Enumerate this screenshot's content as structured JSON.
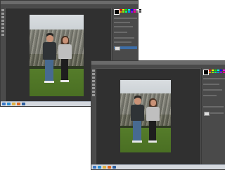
{
  "app": {
    "name": "Adobe Photoshop"
  },
  "colors": {
    "ui_bg": "#535353",
    "canvas_bg": "#303030",
    "panel_bg": "#4a4a4a",
    "selection_blue": "#3d6ea8",
    "taskbar": "#d4d8de"
  },
  "windows": [
    {
      "id": "back",
      "layer_highlighted": true
    },
    {
      "id": "front",
      "layer_highlighted": false
    }
  ],
  "swatch_colors": [
    "#ff0000",
    "#ffff00",
    "#00ff00",
    "#00ffff",
    "#0000ff",
    "#ff00ff",
    "#ffffff",
    "#000000",
    "#ff8800",
    "#88ff00",
    "#00ff88",
    "#0088ff",
    "#8800ff",
    "#ff0088",
    "#888888",
    "#444444"
  ],
  "taskbar_icons": [
    "start-icon",
    "ie-icon",
    "explorer-icon",
    "media-icon",
    "photoshop-icon"
  ]
}
